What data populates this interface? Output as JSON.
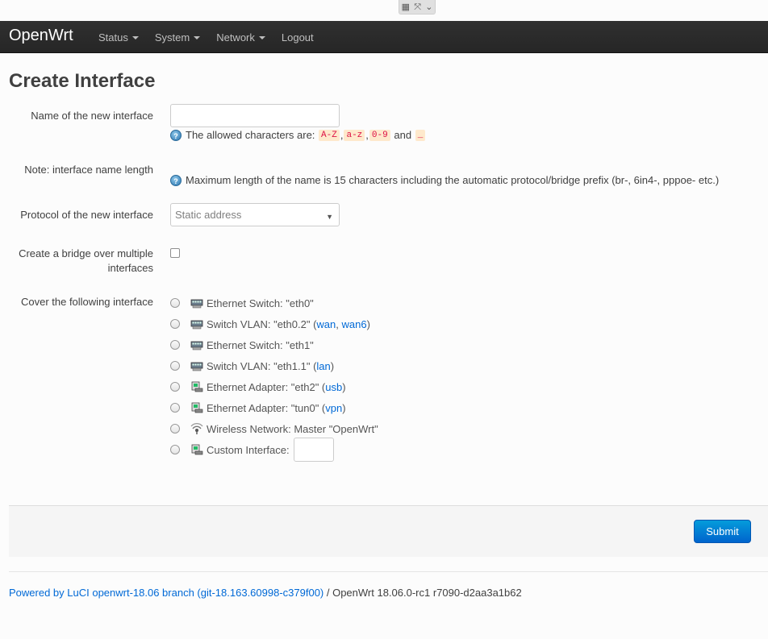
{
  "header": {
    "brand": "OpenWrt",
    "menu": [
      {
        "label": "Status",
        "dropdown": true
      },
      {
        "label": "System",
        "dropdown": true
      },
      {
        "label": "Network",
        "dropdown": true
      },
      {
        "label": "Logout",
        "dropdown": false
      }
    ]
  },
  "page": {
    "title": "Create Interface"
  },
  "form": {
    "name": {
      "label": "Name of the new interface",
      "value": "",
      "hint_prefix": "The allowed characters are:",
      "chars": [
        "A-Z",
        "a-z",
        "0-9"
      ],
      "and": "and",
      "underscore": "_"
    },
    "note": {
      "label": "Note: interface name length",
      "hint": "Maximum length of the name is 15 characters including the automatic protocol/bridge prefix (br-, 6in4-, pppoe- etc.)"
    },
    "protocol": {
      "label": "Protocol of the new interface",
      "selected": "Static address"
    },
    "bridge": {
      "label_line1": "Create a bridge over multiple",
      "label_line2": "interfaces",
      "checked": false
    },
    "cover": {
      "label": "Cover the following interface",
      "options": [
        {
          "text": "Ethernet Switch: \"eth0\"",
          "links": [],
          "icon": "ethernet-switch-icon"
        },
        {
          "text": "Switch VLAN: \"eth0.2\" (",
          "links": [
            "wan",
            "wan6"
          ],
          "suffix": ")",
          "icon": "switch-vlan-icon"
        },
        {
          "text": "Ethernet Switch: \"eth1\"",
          "links": [],
          "icon": "ethernet-switch-icon"
        },
        {
          "text": "Switch VLAN: \"eth1.1\" (",
          "links": [
            "lan"
          ],
          "suffix": ")",
          "icon": "switch-vlan-icon"
        },
        {
          "text": "Ethernet Adapter: \"eth2\" (",
          "links": [
            "usb"
          ],
          "suffix": ")",
          "icon": "ethernet-adapter-icon"
        },
        {
          "text": "Ethernet Adapter: \"tun0\" (",
          "links": [
            "vpn"
          ],
          "suffix": ")",
          "icon": "ethernet-adapter-icon"
        },
        {
          "text": "Wireless Network: Master \"OpenWrt\"",
          "links": [],
          "icon": "wireless-icon"
        },
        {
          "text": "Custom Interface:",
          "links": [],
          "icon": "ethernet-adapter-icon",
          "custom": true
        }
      ]
    }
  },
  "actions": {
    "submit": "Submit"
  },
  "footer": {
    "link": "Powered by LuCI openwrt-18.06 branch (git-18.163.60998-c379f00)",
    "version": " / OpenWrt 18.06.0-rc1 r7090-d2aa3a1b62"
  },
  "colors": {
    "navbar": "#262626",
    "link": "#0069d6",
    "submit": "#0064cd",
    "code_bg": "#fee9cc"
  }
}
